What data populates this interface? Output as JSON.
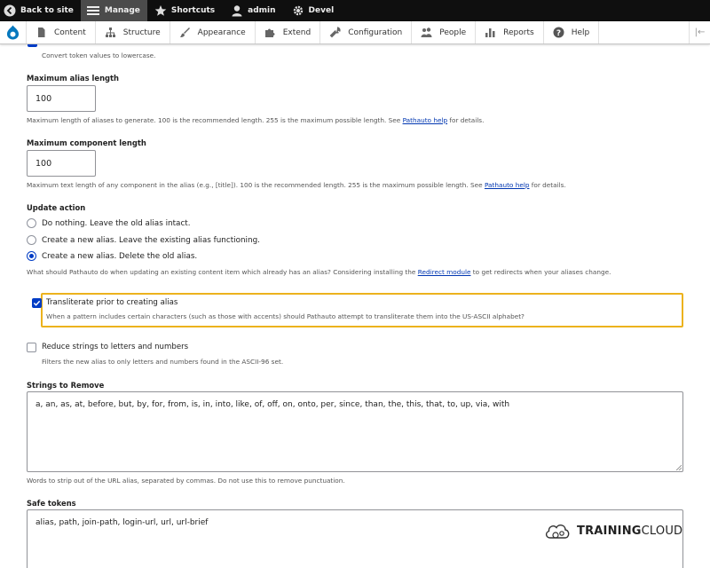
{
  "toolbar": {
    "back": "Back to site",
    "manage": "Manage",
    "shortcuts": "Shortcuts",
    "user": "admin",
    "devel": "Devel"
  },
  "tray": {
    "items": [
      "Content",
      "Structure",
      "Appearance",
      "Extend",
      "Configuration",
      "People",
      "Reports",
      "Help"
    ]
  },
  "form": {
    "lowercase_desc": "Convert token values to lowercase.",
    "max_alias": {
      "label": "Maximum alias length",
      "value": "100",
      "desc_pre": "Maximum length of aliases to generate. 100 is the recommended length. 255 is the maximum possible length. See ",
      "desc_link": "Pathauto help",
      "desc_post": " for details."
    },
    "max_component": {
      "label": "Maximum component length",
      "value": "100",
      "desc_pre": "Maximum text length of any component in the alias (e.g., [title]). 100 is the recommended length. 255 is the maximum possible length. See ",
      "desc_link": "Pathauto help",
      "desc_post": " for details."
    },
    "update_action": {
      "label": "Update action",
      "options": [
        "Do nothing. Leave the old alias intact.",
        "Create a new alias. Leave the existing alias functioning.",
        "Create a new alias. Delete the old alias."
      ],
      "selected_index": 2,
      "desc_pre": "What should Pathauto do when updating an existing content item which already has an alias? Considering installing the ",
      "desc_link": "Redirect module",
      "desc_post": " to get redirects when your aliases change."
    },
    "transliterate": {
      "label": "Transliterate prior to creating alias",
      "checked": true,
      "desc": "When a pattern includes certain characters (such as those with accents) should Pathauto attempt to transliterate them into the US-ASCII alphabet?"
    },
    "reduce": {
      "label": "Reduce strings to letters and numbers",
      "checked": false,
      "desc": "Filters the new alias to only letters and numbers found in the ASCII-96 set."
    },
    "strings_remove": {
      "label": "Strings to Remove",
      "value": "a, an, as, at, before, but, by, for, from, is, in, into, like, of, off, on, onto, per, since, than, the, this, that, to, up, via, with",
      "desc": "Words to strip out of the URL alias, separated by commas. Do not use this to remove punctuation."
    },
    "safe_tokens": {
      "label": "Safe tokens",
      "value": "alias, path, join-path, login-url, url, url-brief"
    }
  },
  "watermark": {
    "bold": "TRAINING",
    "rest": "CLOUD"
  },
  "colors": {
    "accent": "#003cc5",
    "highlight": "#ecb21d",
    "link": "#0036b1"
  }
}
